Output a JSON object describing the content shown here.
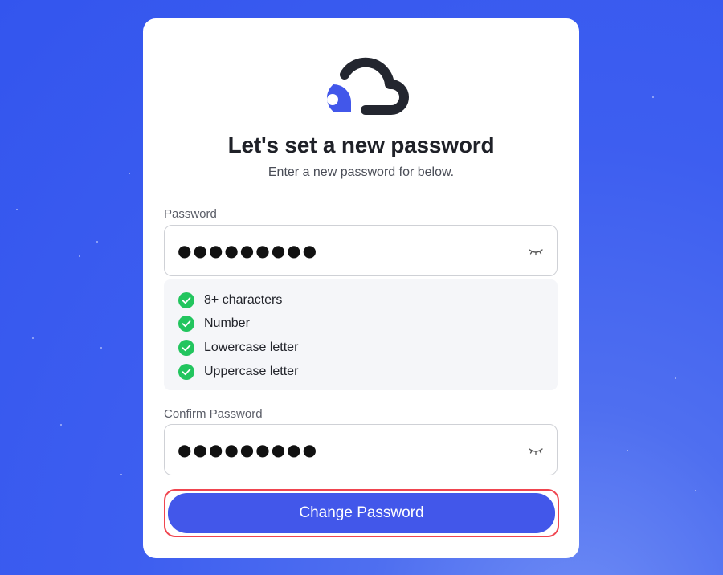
{
  "colors": {
    "accent": "#4257ea",
    "success": "#22c55e",
    "highlight_border": "#f0454f"
  },
  "logo": {
    "icon": "cloud-pin-logo-icon"
  },
  "header": {
    "title": "Let's set a new password",
    "subtitle": "Enter a new password for below."
  },
  "password": {
    "label": "Password",
    "value": "●●●●●●●●●",
    "toggle_icon": "eye-closed-icon"
  },
  "requirements": [
    {
      "label": "8+ characters",
      "met": true
    },
    {
      "label": "Number",
      "met": true
    },
    {
      "label": "Lowercase letter",
      "met": true
    },
    {
      "label": "Uppercase letter",
      "met": true
    }
  ],
  "confirm": {
    "label": "Confirm Password",
    "value": "●●●●●●●●●",
    "toggle_icon": "eye-closed-icon"
  },
  "submit": {
    "label": "Change Password"
  }
}
